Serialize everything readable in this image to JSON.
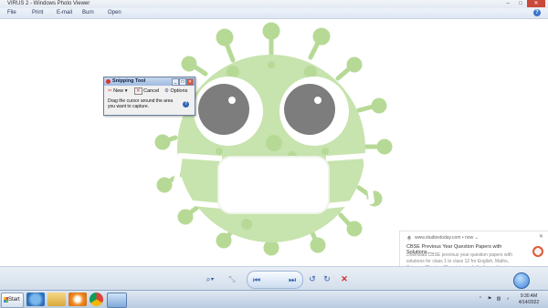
{
  "window": {
    "title": "VIRUS 2 - Windows Photo Viewer",
    "minimize": "–",
    "maximize": "□",
    "close": "✕"
  },
  "menu": {
    "items": [
      "File",
      "Print",
      "E-mail",
      "Burn",
      "Open"
    ],
    "help_label": "?"
  },
  "colors": {
    "virus_body": "#c7e3ae",
    "virus_spikes": "#b7d996",
    "eye_gray": "#7d7d7d",
    "accent_blue": "#2f5da8"
  },
  "snipping_tool": {
    "title": "Snipping Tool",
    "new_label": "New",
    "cancel_label": "Cancel",
    "options_label": "Options",
    "message": "Drag the cursor around the area you want to capture.",
    "help_label": "?"
  },
  "viewer_toolbar": {
    "zoom_icon": "magnifier-icon",
    "fit_icon": "actual-size-icon",
    "prev_icon": "previous-icon",
    "slideshow_icon": "slideshow-icon",
    "next_icon": "next-icon",
    "rotate_ccw_icon": "rotate-counterclockwise-icon",
    "rotate_cw_icon": "rotate-clockwise-icon",
    "delete_icon": "delete-icon"
  },
  "notification": {
    "source": "www.studiestoday.com",
    "source_suffix": "• now ⌄",
    "title": "CBSE Previous Year Question Papers with Solutions...",
    "body": "Download CBSE previous year question papers with solutions for class 1 to class 12 for English, Maths, Science, Physics, Chemistry and all other subjects, available for free download in pdf",
    "close": "✕"
  },
  "taskbar": {
    "start_label": "Start",
    "time": "9:30 AM",
    "date": "4/14/2022"
  }
}
